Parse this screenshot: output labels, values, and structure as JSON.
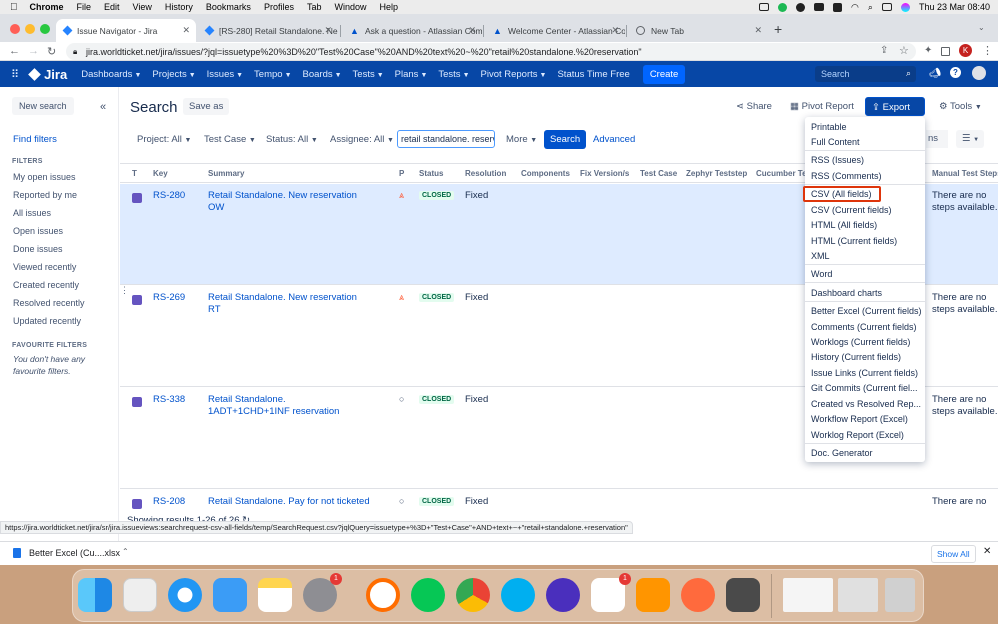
{
  "menubar": {
    "apple": "",
    "app": "Chrome",
    "items": [
      "File",
      "Edit",
      "View",
      "History",
      "Bookmarks",
      "Profiles",
      "Tab",
      "Window",
      "Help"
    ],
    "clock": "Thu 23 Mar  08:40"
  },
  "tabs": [
    {
      "label": "Issue Navigator - Jira",
      "favicon": "jira-icon"
    },
    {
      "label": "[RS-280] Retail Standalone. Ne",
      "favicon": "jira-icon"
    },
    {
      "label": "Ask a question - Atlassian Com",
      "favicon": "atlassian-icon"
    },
    {
      "label": "Welcome Center - Atlassian Co",
      "favicon": "atlassian-icon"
    },
    {
      "label": "New Tab",
      "favicon": "globe-icon"
    }
  ],
  "address": "jira.worldticket.net/jira/issues/?jql=issuetype%20%3D%20\"Test%20Case\"%20AND%20text%20~%20\"retail%20standalone.%20reservation\"",
  "profile_initial": "K",
  "topnav": {
    "logo": "Jira",
    "items": [
      "Dashboards",
      "Projects",
      "Issues",
      "Tempo",
      "Boards",
      "Tests",
      "Plans",
      "Tests",
      "Pivot Reports"
    ],
    "status_time": "Status Time Free",
    "create": "Create",
    "search_placeholder": "Search"
  },
  "sidebar": {
    "new_search": "New search",
    "find_filters": "Find filters",
    "filters_heading": "FILTERS",
    "filters": [
      "My open issues",
      "Reported by me",
      "All issues",
      "Open issues",
      "Done issues",
      "Viewed recently",
      "Created recently",
      "Resolved recently",
      "Updated recently"
    ],
    "favourite_heading": "FAVOURITE FILTERS",
    "favourite_empty": "You don't have any favourite filters."
  },
  "header": {
    "title": "Search",
    "save_as": "Save as",
    "share": "Share",
    "pivot_report": "Pivot Report",
    "export": "Export",
    "tools": "Tools"
  },
  "filters": {
    "project": "Project: All",
    "testcase": "Test Case",
    "status": "Status: All",
    "assignee": "Assignee: All",
    "text": "retail standalone. reserv",
    "more": "More",
    "search": "Search",
    "advanced": "Advanced",
    "columns_partial": "ns"
  },
  "table": {
    "headers": [
      "T",
      "Key",
      "Summary",
      "P",
      "Status",
      "Resolution",
      "Components",
      "Fix Version/s",
      "Test Case",
      "Zephyr Teststep",
      "Cucumber Tes",
      "Manual Test Steps"
    ],
    "rows": [
      {
        "key": "RS-280",
        "summary": "Retail Standalone. New reservation OW",
        "priority": "⩓",
        "status": "CLOSED",
        "resolution": "Fixed",
        "steps": "There are no steps available."
      },
      {
        "key": "RS-269",
        "summary": "Retail Standalone. New reservation RT",
        "priority": "⩓",
        "status": "CLOSED",
        "resolution": "Fixed",
        "steps": "There are no steps available."
      },
      {
        "key": "RS-338",
        "summary": "Retail Standalone. 1ADT+1CHD+1INF reservation",
        "priority": "○",
        "status": "CLOSED",
        "resolution": "Fixed",
        "steps": "There are no steps available."
      },
      {
        "key": "RS-208",
        "summary": "Retail Standalone. Pay for not ticketed",
        "priority": "○",
        "status": "CLOSED",
        "resolution": "Fixed",
        "steps": "There are no"
      }
    ],
    "showing": "Showing results 1-26 of 26"
  },
  "status_url": "https://jira.worldticket.net/jira/sr/jira.issueviews:searchrequest-csv-all-fields/temp/SearchRequest.csv?jqlQuery=issuetype+%3D+\"Test+Case\"+AND+text+~+\"retail+standalone.+reservation\"",
  "export_menu": {
    "items": [
      "Printable",
      "Full Content",
      "RSS (Issues)",
      "RSS (Comments)",
      "CSV (All fields)",
      "CSV (Current fields)",
      "HTML (All fields)",
      "HTML (Current fields)",
      "XML",
      "Word",
      "Dashboard charts",
      "Better Excel (Current fields)",
      "Comments (Current fields)",
      "Worklogs (Current fields)",
      "History (Current fields)",
      "Issue Links (Current fields)",
      "Git Commits (Current fiel...",
      "Created vs Resolved Rep...",
      "Workflow Report (Excel)",
      "Worklog Report (Excel)",
      "Doc. Generator"
    ],
    "highlighted": "CSV (All fields)"
  },
  "downloads": {
    "file": "Better Excel (Cu....xlsx",
    "show_all": "Show All"
  },
  "dock_badges": {
    "settings": "1",
    "slack": "1"
  }
}
